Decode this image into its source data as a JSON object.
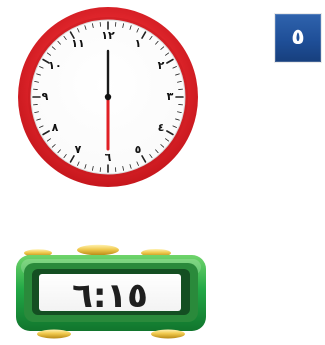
{
  "question": {
    "number": "٥"
  },
  "analog_clock": {
    "numerals": [
      "١٢",
      "١",
      "٢",
      "٣",
      "٤",
      "٥",
      "٦",
      "٧",
      "٨",
      "٩",
      "١٠",
      "١١"
    ],
    "hour_hand_value": 6,
    "minute_hand_value": 0
  },
  "digital_clock": {
    "time": "٦:١٥"
  },
  "colors": {
    "clock_rim": "#e21f26",
    "badge_blue": "#214f99",
    "digital_green": "#1f9c3f",
    "digital_gold": "#d8b12b"
  },
  "icons": {
    "analog": "analog-clock-icon",
    "digital": "digital-clock-icon"
  }
}
